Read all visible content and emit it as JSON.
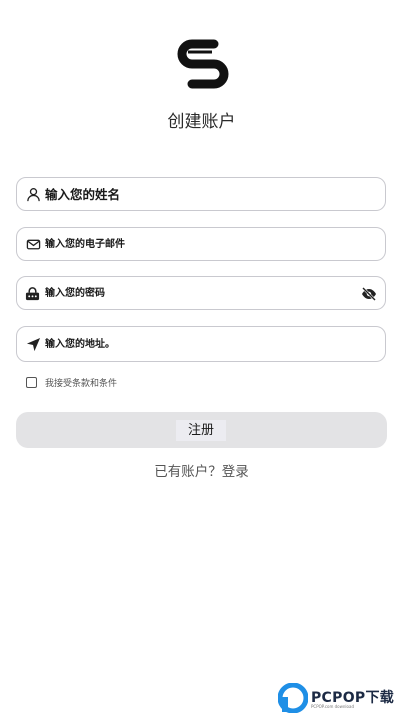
{
  "header": {
    "logo_icon": "s-link-logo-icon",
    "title": "创建账户"
  },
  "form": {
    "name_placeholder": "输入您的姓名",
    "email_placeholder": "输入您的电子邮件",
    "password_placeholder": "输入您的密码",
    "address_placeholder": "输入您的地址。",
    "agree_label": "我接受条款和条件",
    "agree_checked": false,
    "register_label": "注册"
  },
  "footer": {
    "login_prompt": "已有账户？登录"
  },
  "watermark": {
    "brand": "PCPOP下载",
    "sub": "PCPOP.com download"
  },
  "colors": {
    "border": "#c9c9cf",
    "button_bg": "#e3e3e5",
    "text": "#1a1a1a",
    "muted": "#555555",
    "watermark_blue": "#1f8fe6"
  }
}
